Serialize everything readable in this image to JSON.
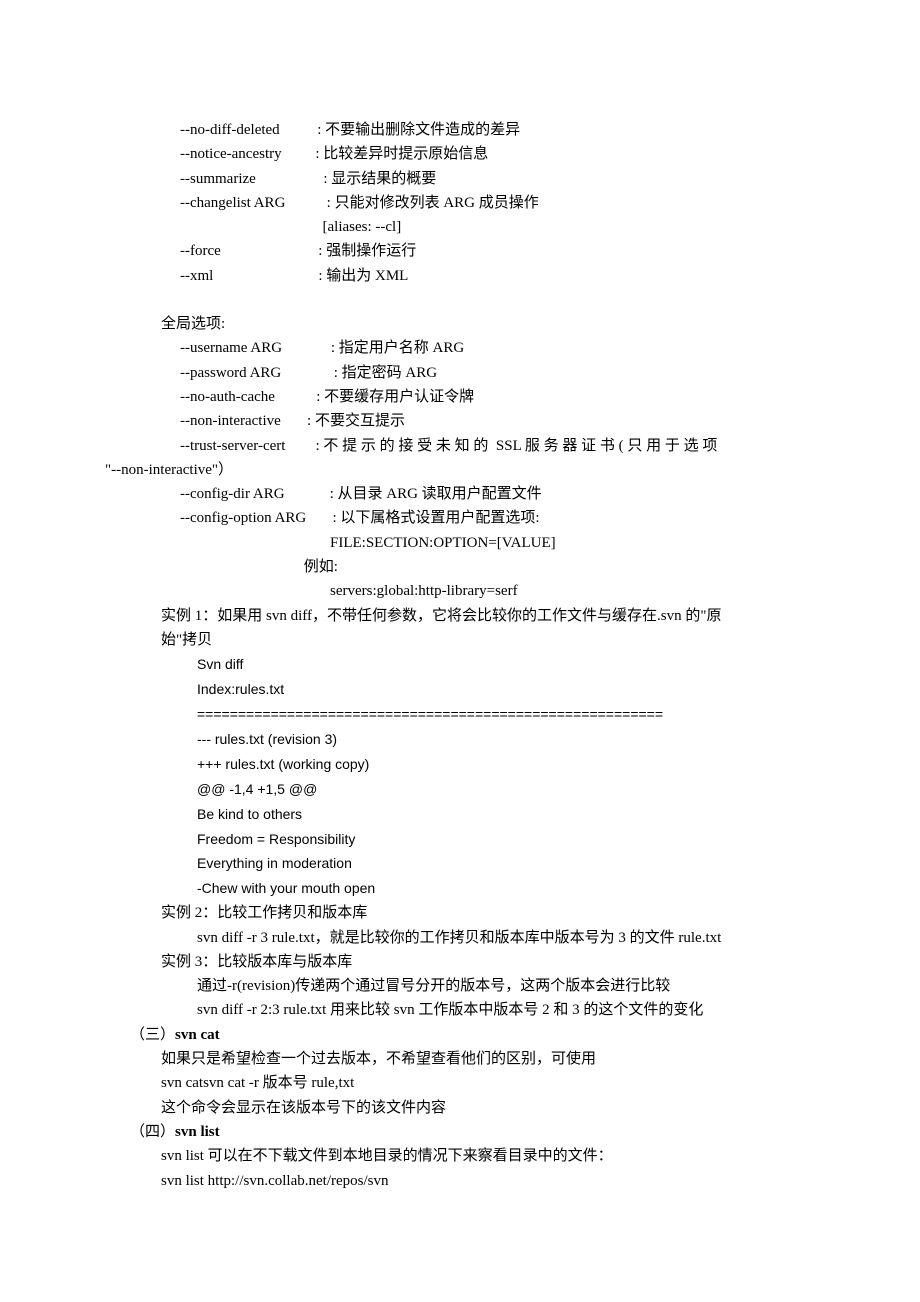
{
  "options": [
    {
      "flag": "--no-diff-deleted",
      "desc": "不要输出删除文件造成的差异",
      "gap": "          "
    },
    {
      "flag": "--notice-ancestry",
      "desc": "比较差异时提示原始信息",
      "gap": "         "
    },
    {
      "flag": "--summarize",
      "desc": "显示结果的概要",
      "gap": "                  "
    },
    {
      "flag": "--changelist ARG",
      "desc": "只能对修改列表 ARG 成员操作",
      "gap": "           "
    }
  ],
  "alias_line": "                                      [aliases: --cl]",
  "options2": [
    {
      "flag": "--force",
      "desc": "强制操作运行",
      "gap": "                          "
    },
    {
      "flag": "--xml",
      "desc": "输出为 XML",
      "gap": "                            "
    }
  ],
  "global_header": "全局选项:",
  "globals": [
    {
      "flag": "--username ARG",
      "desc": "指定用户名称 ARG",
      "gap": "             "
    },
    {
      "flag": "--password ARG",
      "desc": "指定密码 ARG",
      "gap": "              "
    },
    {
      "flag": "--no-auth-cache",
      "desc": "不要缓存用户认证令牌",
      "gap": "           "
    },
    {
      "flag": "--non-interactive",
      "desc": "不要交互提示",
      "gap": "       "
    },
    {
      "flag": "--trust-server-cert",
      "desc": "不 提 示 的 接 受 未 知 的  SSL 服 务 器 证 书 ( 只 用 于 选 项",
      "gap": "        "
    }
  ],
  "noninteractive_wrap": "\"--non-interactive\"）",
  "globals2": [
    {
      "flag": "--config-dir ARG",
      "desc": "从目录 ARG 读取用户配置文件",
      "gap": "            "
    },
    {
      "flag": "--config-option ARG",
      "desc": "以下属格式设置用户配置选项:",
      "gap": "       "
    }
  ],
  "config_example1": "                                        FILE:SECTION:OPTION=[VALUE]",
  "config_example2": "                                 例如:",
  "config_example3": "                                        servers:global:http-library=serf",
  "ex1_a": "实例 1：如果用 svn diff，不带任何参数，它将会比较你的工作文件与缓存在.svn 的\"原",
  "ex1_b": "始\"拷贝",
  "diff": {
    "l1": "Svn diff",
    "l2": "Index:rules.txt",
    "l3": "=========================================================",
    "l4": "--- rules.txt (revision 3)",
    "l5": "+++ rules.txt (working copy)",
    "l6": "@@ -1,4 +1,5 @@",
    "l7": "Be kind to others",
    "l8": "Freedom = Responsibility",
    "l9": "Everything in moderation",
    "l10": "-Chew with your mouth open"
  },
  "ex2_head": "实例 2：比较工作拷贝和版本库",
  "ex2_body": "svn diff -r 3 rule.txt，就是比较你的工作拷贝和版本库中版本号为 3 的文件 rule.txt",
  "ex3_head": "实例 3：比较版本库与版本库",
  "ex3_b1": "通过-r(revision)传递两个通过冒号分开的版本号，这两个版本会进行比较",
  "ex3_b2": "svn diff -r 2:3 rule.txt 用来比较 svn 工作版本中版本号 2 和 3 的这个文件的变化",
  "s3_num": "（三）",
  "s3_title": "svn cat",
  "s3_l1": "如果只是希望检查一个过去版本，不希望查看他们的区别，可使用",
  "s3_l2": "svn catsvn cat -r  版本号  rule,txt",
  "s3_l3": "这个命令会显示在该版本号下的该文件内容",
  "s4_num": "（四）",
  "s4_title": "svn list",
  "s4_l1": "svn list 可以在不下载文件到本地目录的情况下来察看目录中的文件：",
  "s4_l2": "svn list http://svn.collab.net/repos/svn"
}
